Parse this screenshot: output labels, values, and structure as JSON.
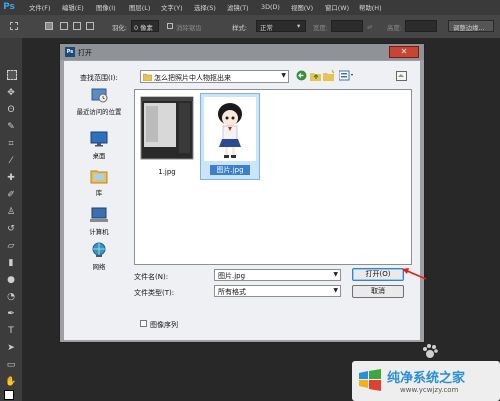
{
  "app": {
    "logo": "Ps",
    "menu": [
      "文件(F)",
      "编辑(E)",
      "图像(I)",
      "图层(L)",
      "文字(Y)",
      "选择(S)",
      "滤镜(T)",
      "3D(D)",
      "视图(V)",
      "窗口(W)",
      "帮助(H)"
    ]
  },
  "options_bar": {
    "feather_label": "羽化:",
    "feather_value": "0 像素",
    "antialias_label": "消除锯齿",
    "style_label": "样式:",
    "style_value": "正常",
    "width_label": "宽度:",
    "height_label": "高度:",
    "refine_edge": "调整边缘..."
  },
  "dialog": {
    "title": "打开",
    "close_glyph": "✕",
    "look_in_label": "查找范围(I):",
    "look_in_value": "怎么把照片中人物抠出来",
    "places": [
      {
        "label": "最近访问的位置",
        "icon": "recent-places-icon"
      },
      {
        "label": "桌面",
        "icon": "desktop-icon"
      },
      {
        "label": "库",
        "icon": "library-icon"
      },
      {
        "label": "计算机",
        "icon": "computer-icon"
      },
      {
        "label": "网络",
        "icon": "network-icon"
      }
    ],
    "files": [
      {
        "name": "1.jpg",
        "selected": false
      },
      {
        "name": "图片.jpg",
        "selected": true
      }
    ],
    "filename_label": "文件名(N):",
    "filename_value": "图片.jpg",
    "filetype_label": "文件类型(T):",
    "filetype_value": "所有格式",
    "open_button": "打开(O)",
    "cancel_button": "取消",
    "image_sequence_label": "图像序列"
  },
  "watermark": {
    "title": "纯净系统之家",
    "url": "www.ycwjzy.com"
  },
  "colors": {
    "ps_blue": "#39a3f6",
    "close_red": "#c64535",
    "annotation_red": "#e02020",
    "selection_blue": "#cce4f7"
  }
}
